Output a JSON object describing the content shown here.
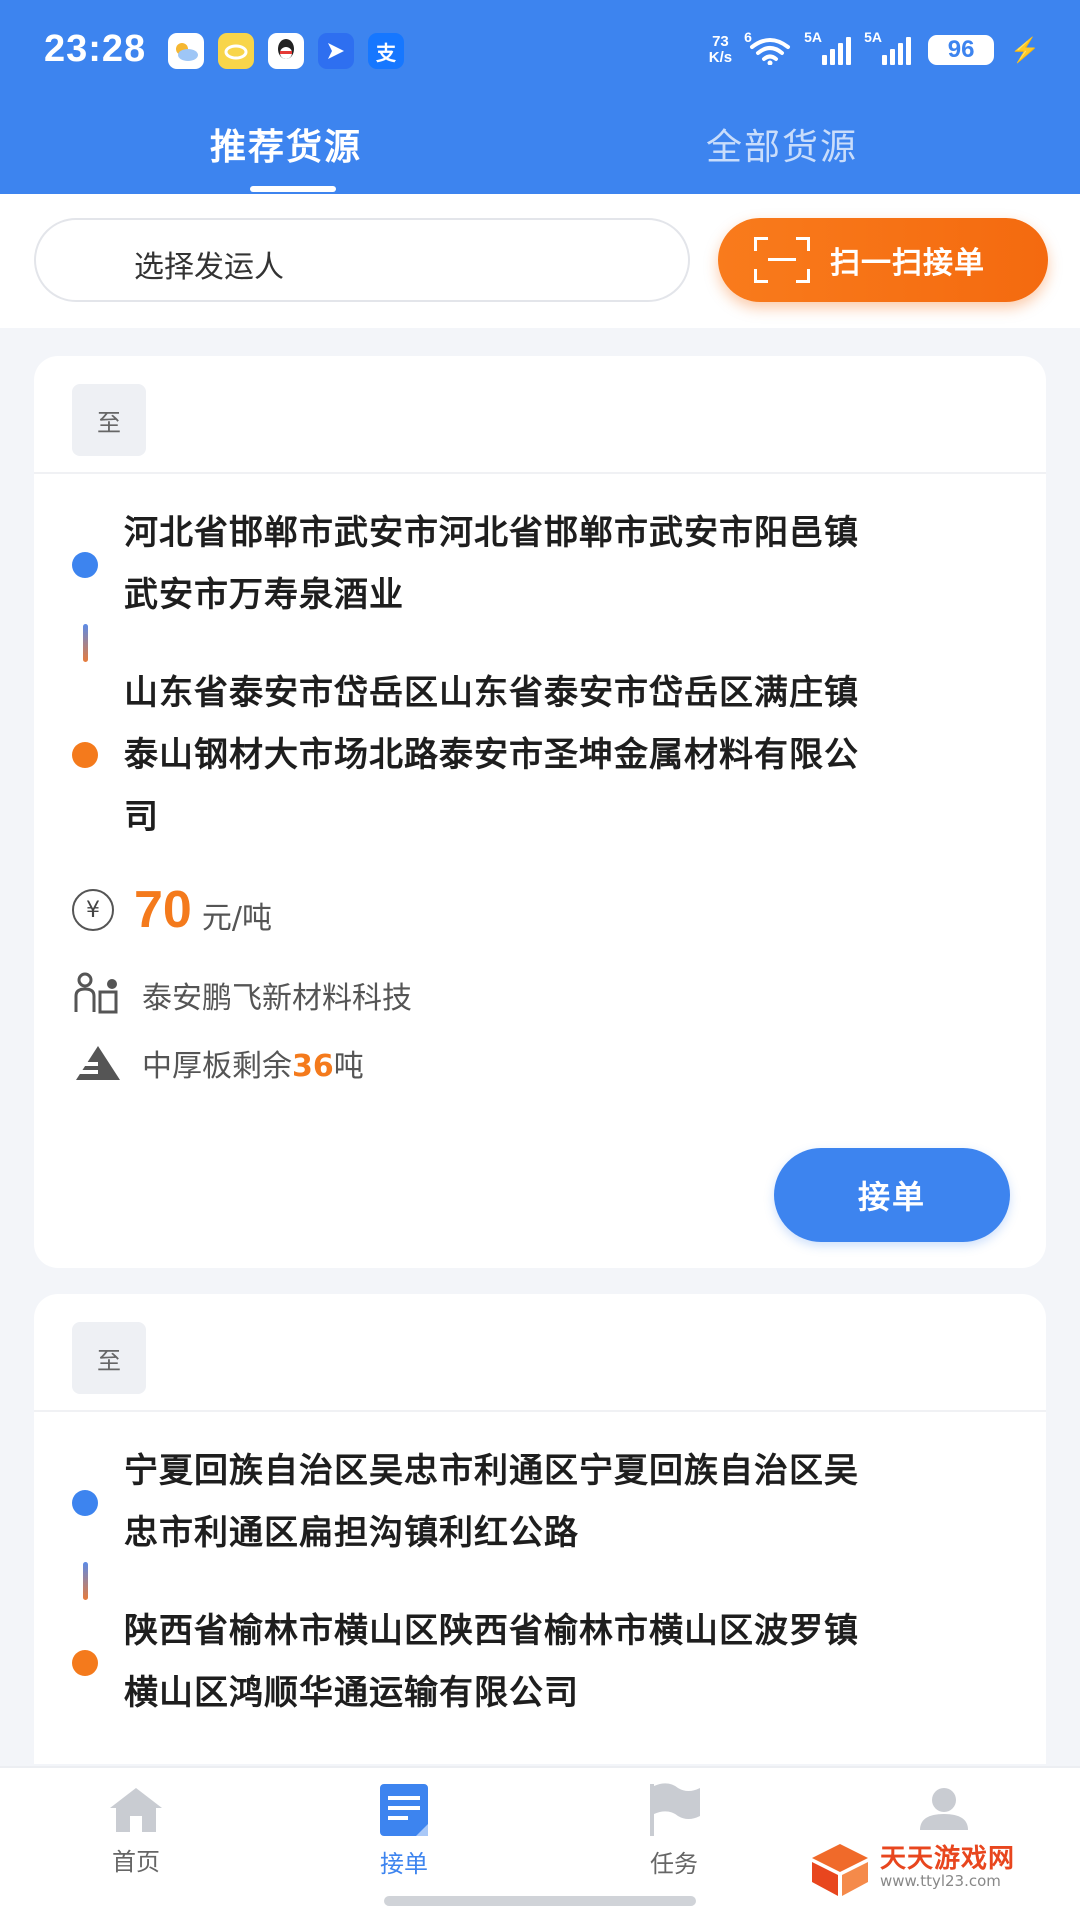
{
  "status_bar": {
    "time": "23:28",
    "net_speed_value": "73",
    "net_speed_unit": "K/s",
    "wifi_tag": "6",
    "sim1_tag": "5A",
    "sim2_tag": "5A",
    "battery": "96",
    "app_icons": [
      "weather-icon",
      "cloud-app-icon",
      "qq-icon",
      "send-app-icon",
      "alipay-icon"
    ],
    "alipay_glyph": "支"
  },
  "top_tabs": [
    {
      "label": "推荐货源",
      "active": true
    },
    {
      "label": "全部货源",
      "active": false
    }
  ],
  "filter": {
    "shipper_placeholder": "选择发运人",
    "scan_label": "扫一扫接单"
  },
  "cards": [
    {
      "badge": "至",
      "origin_lines": [
        "河北省邯郸市武安市河北省邯郸市武安市阳邑镇",
        "武安市万寿泉酒业"
      ],
      "dest_lines": [
        "山东省泰安市岱岳区山东省泰安市岱岳区满庄镇",
        "泰山钢材大市场北路泰安市圣坤金属材料有限公",
        "司"
      ],
      "price_value": "70",
      "price_unit": "元/吨",
      "shipper": "泰安鹏飞新材料科技",
      "cargo_prefix": "中厚板剩余",
      "cargo_qty": "36",
      "cargo_unit": "吨",
      "accept_label": "接单"
    },
    {
      "badge": "至",
      "origin_lines": [
        "宁夏回族自治区吴忠市利通区宁夏回族自治区吴",
        "忠市利通区扁担沟镇利红公路"
      ],
      "dest_lines": [
        "陕西省榆林市横山区陕西省榆林市横山区波罗镇",
        "横山区鸿顺华通运输有限公司"
      ]
    }
  ],
  "bottom_nav": [
    {
      "label": "首页",
      "icon": "home-icon",
      "active": false
    },
    {
      "label": "接单",
      "icon": "order-doc-icon",
      "active": true
    },
    {
      "label": "任务",
      "icon": "flag-icon",
      "active": false
    },
    {
      "label": "",
      "icon": "profile-icon",
      "active": false
    }
  ],
  "watermark": {
    "title": "天天游戏网",
    "url": "www.ttyl23.com"
  },
  "colors": {
    "brand_blue": "#3d84ef",
    "accent_orange": "#f47a1c"
  }
}
